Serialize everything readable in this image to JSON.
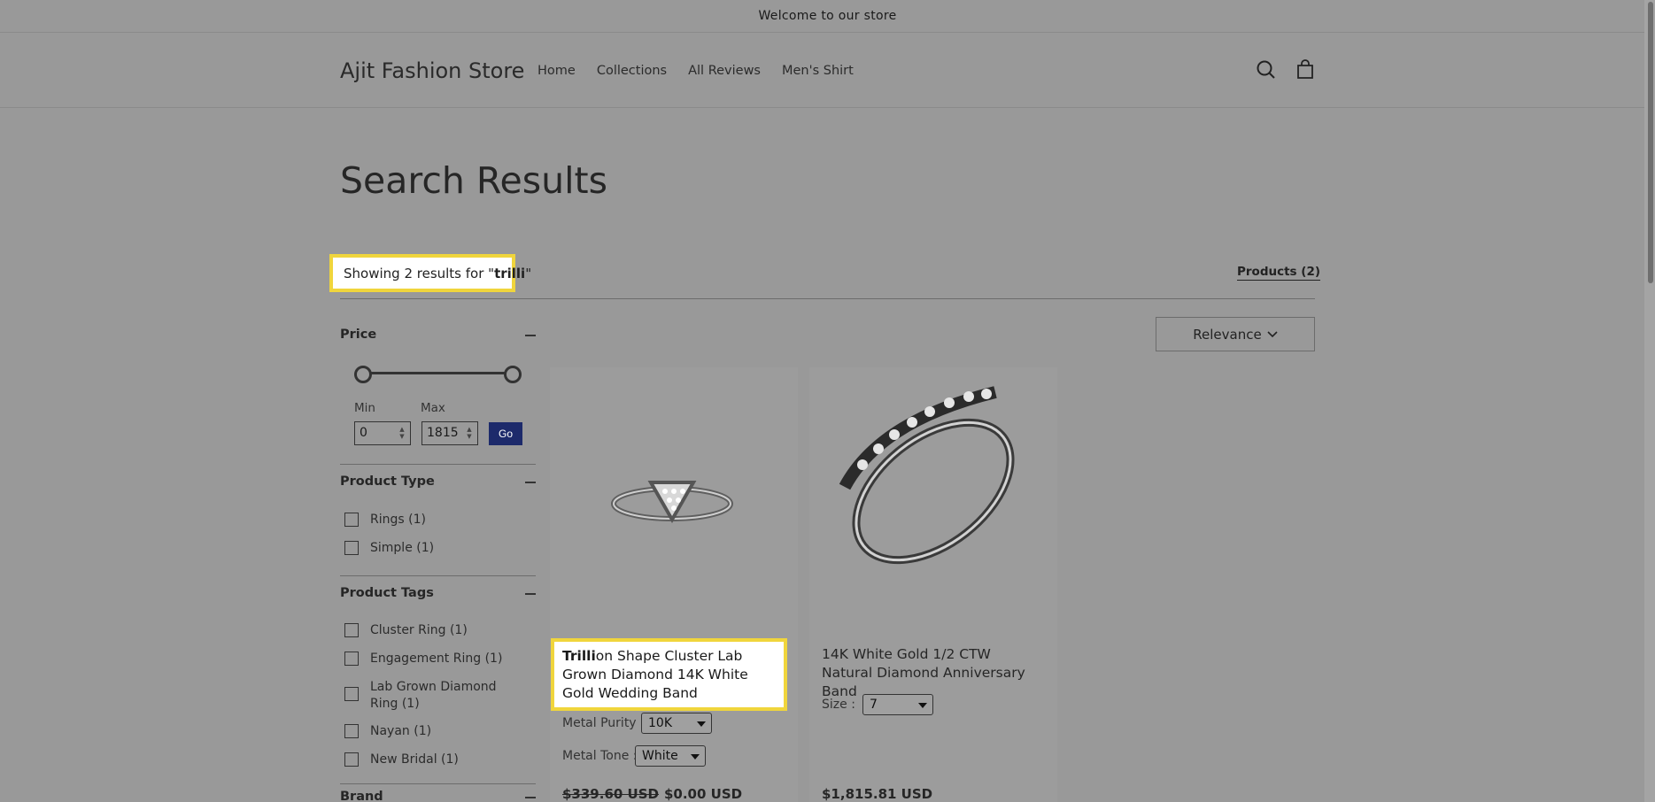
{
  "announcement": "Welcome to our store",
  "header": {
    "logo": "Ajit Fashion Store",
    "nav": [
      "Home",
      "Collections",
      "All Reviews",
      "Men's Shirt"
    ]
  },
  "page_title": "Search Results",
  "results": {
    "prefix": "Showing 2 results for \"",
    "query": "trilli",
    "suffix": "\""
  },
  "products_tab": "Products (2)",
  "sort": {
    "selected": "Relevance"
  },
  "filters": {
    "price": {
      "title": "Price",
      "min_label": "Min",
      "max_label": "Max",
      "min_value": "0",
      "max_value": "1815",
      "go_label": "Go"
    },
    "product_type": {
      "title": "Product Type",
      "options": [
        "Rings (1)",
        "Simple (1)"
      ]
    },
    "product_tags": {
      "title": "Product Tags",
      "options": [
        "Cluster Ring (1)",
        "Engagement Ring (1)",
        "Lab Grown Diamond Ring (1)",
        "Nayan (1)",
        "New Bridal (1)"
      ]
    },
    "brand": {
      "title": "Brand"
    }
  },
  "products": [
    {
      "title_match": "Trilli",
      "title_rest": "on Shape Cluster Lab Grown Diamond 14K White Gold Wedding Band",
      "options": [
        {
          "label": "Metal Purity :",
          "value": "10K"
        },
        {
          "label": "Metal Tone :",
          "value": "White"
        }
      ],
      "compare_price": "$339.60 USD",
      "price": "$0.00 USD"
    },
    {
      "title": "14K White Gold 1/2 CTW Natural Diamond Anniversary Band",
      "options": [
        {
          "label": "Size :",
          "value": "7"
        }
      ],
      "price": "$1,815.81 USD"
    }
  ],
  "colors": {
    "highlight_border": "#f0d53c",
    "go_button": "#1d2a6b",
    "overlay_bg": "#999999"
  }
}
